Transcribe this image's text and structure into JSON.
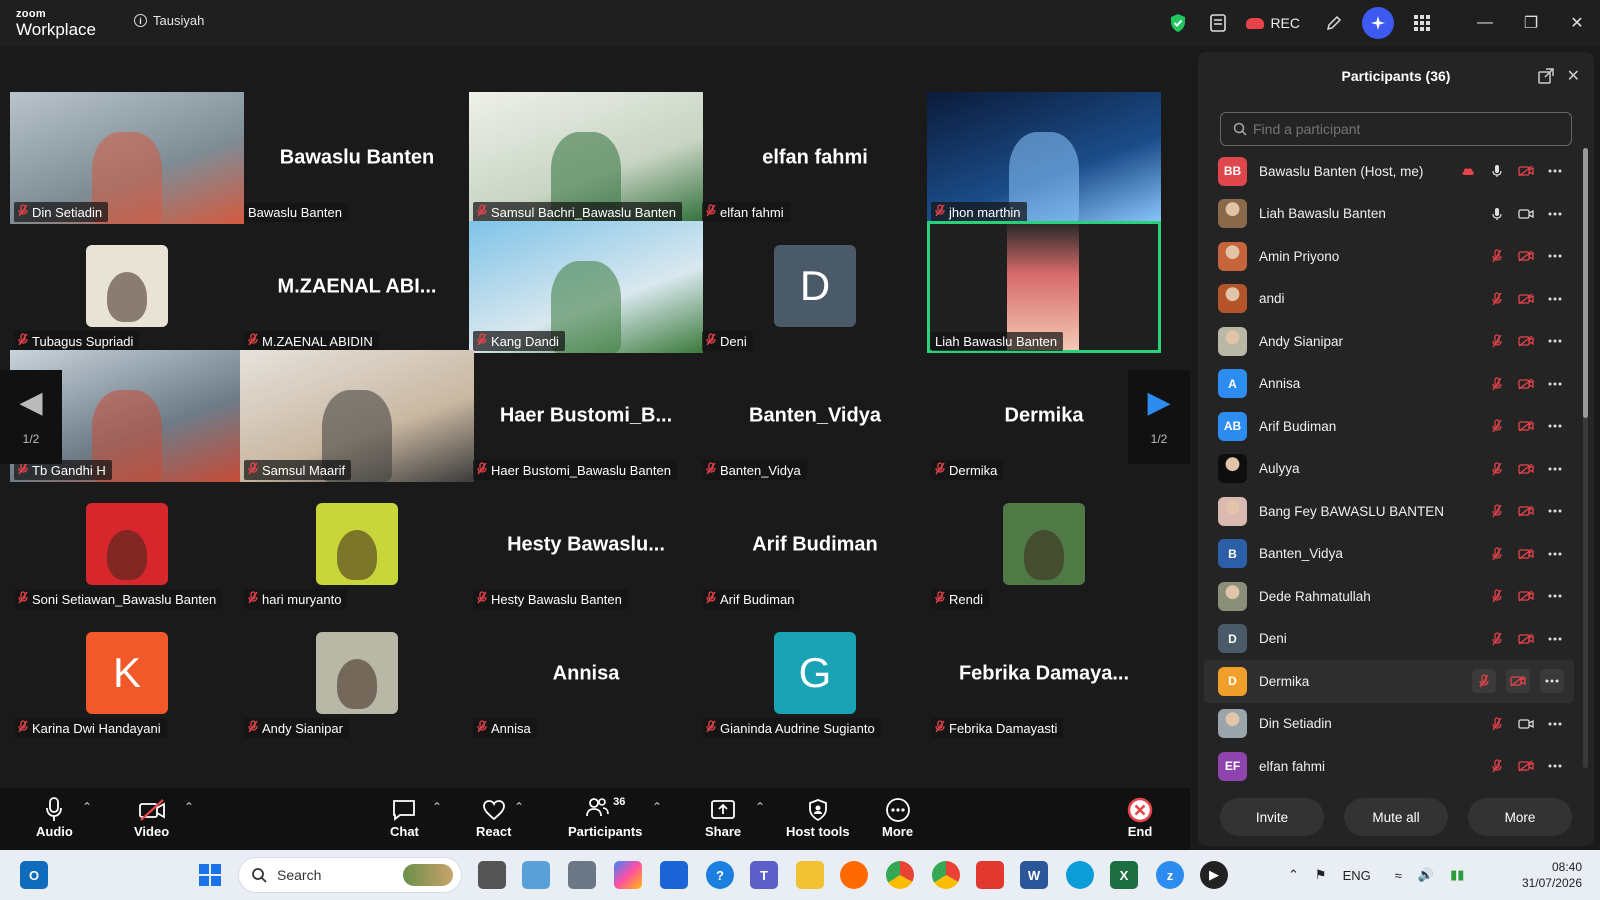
{
  "window": {
    "brand_top": "zoom",
    "brand_bottom": "Workplace",
    "meeting_title": "Tausiyah",
    "rec_label": "REC"
  },
  "grid": {
    "page_indicator": "1/2",
    "tiles": [
      {
        "name": "Din Setiadin",
        "center_label": "",
        "kind": "image",
        "palette": [
          "#b9c4cc",
          "#7e8c95",
          "#d45a3f"
        ],
        "muted": true
      },
      {
        "name": "Bawaslu Banten",
        "center_label": "Bawaslu Banten",
        "kind": "name",
        "muted": false
      },
      {
        "name": "Samsul Bachri_Bawaslu Banten",
        "center_label": "",
        "kind": "image",
        "palette": [
          "#eef0ea",
          "#c8d4c3",
          "#2f6f3a"
        ],
        "muted": true
      },
      {
        "name": "elfan fahmi",
        "center_label": "elfan fahmi",
        "kind": "name",
        "muted": true
      },
      {
        "name": "jhon marthin",
        "center_label": "",
        "kind": "image",
        "palette": [
          "#0b1b3a",
          "#1b4d8a",
          "#8ec8ff"
        ],
        "muted": true
      },
      {
        "name": "Tubagus Supriadi",
        "center_label": "",
        "kind": "avatar",
        "palette": [
          "#e9e3d6"
        ],
        "muted": true
      },
      {
        "name": "M.ZAENAL ABIDIN",
        "center_label": "M.ZAENAL  ABI...",
        "kind": "name",
        "muted": true
      },
      {
        "name": "Kang Dandi",
        "center_label": "",
        "kind": "image",
        "palette": [
          "#7fc3e8",
          "#d9e8ef",
          "#3b7a3a"
        ],
        "muted": true
      },
      {
        "name": "Deni",
        "center_label": "",
        "kind": "letter",
        "letter": "D",
        "palette": [
          "#4a5a68"
        ],
        "muted": true
      },
      {
        "name": "Liah Bawaslu Banten",
        "center_label": "",
        "kind": "speaker",
        "palette": [
          "#2a2a2a",
          "#d86b6b",
          "#f3c9b5"
        ],
        "muted": false
      },
      {
        "name": "Tb Gandhi H",
        "center_label": "",
        "kind": "image",
        "palette": [
          "#c9d3db",
          "#6d7c88",
          "#c84a35"
        ],
        "muted": true
      },
      {
        "name": "Samsul Maarif",
        "center_label": "",
        "kind": "image",
        "palette": [
          "#e6e2dc",
          "#c9b7a1",
          "#3b3b3b"
        ],
        "muted": true
      },
      {
        "name": "Haer Bustomi_Bawaslu Banten",
        "center_label": "Haer  Bustomi_B...",
        "kind": "name",
        "muted": true
      },
      {
        "name": "Banten_Vidya",
        "center_label": "Banten_Vidya",
        "kind": "name",
        "muted": true
      },
      {
        "name": "Dermika",
        "center_label": "Dermika",
        "kind": "name",
        "muted": true
      },
      {
        "name": "Soni Setiawan_Bawaslu Banten",
        "center_label": "",
        "kind": "avatar",
        "palette": [
          "#d8272c"
        ],
        "muted": true
      },
      {
        "name": "hari muryanto",
        "center_label": "",
        "kind": "avatar",
        "palette": [
          "#c9d63a"
        ],
        "muted": true
      },
      {
        "name": "Hesty Bawaslu Banten",
        "center_label": "Hesty  Bawaslu...",
        "kind": "name",
        "muted": true
      },
      {
        "name": "Arif Budiman",
        "center_label": "Arif Budiman",
        "kind": "name",
        "muted": true
      },
      {
        "name": "Rendi",
        "center_label": "",
        "kind": "avatar",
        "palette": [
          "#4f7a45"
        ],
        "muted": true
      },
      {
        "name": "Karina Dwi Handayani",
        "center_label": "",
        "kind": "letter",
        "letter": "K",
        "palette": [
          "#f2592a"
        ],
        "muted": true
      },
      {
        "name": "Andy Sianipar",
        "center_label": "",
        "kind": "avatar",
        "palette": [
          "#b9b7a6"
        ],
        "muted": true
      },
      {
        "name": "Annisa",
        "center_label": "Annisa",
        "kind": "name",
        "muted": true
      },
      {
        "name": "Gianinda Audrine Sugianto",
        "center_label": "",
        "kind": "letter",
        "letter": "G",
        "palette": [
          "#1aa3b5"
        ],
        "muted": true
      },
      {
        "name": "Febrika Damayasti",
        "center_label": "Febrika  Damaya...",
        "kind": "name",
        "muted": true
      }
    ]
  },
  "toolbar": {
    "audio": "Audio",
    "video": "Video",
    "chat": "Chat",
    "react": "React",
    "participants": "Participants",
    "participants_count": "36",
    "share": "Share",
    "host_tools": "Host tools",
    "more": "More",
    "end": "End"
  },
  "panel": {
    "title": "Participants (36)",
    "search_placeholder": "Find a participant",
    "invite": "Invite",
    "mute_all": "Mute all",
    "more": "More",
    "participants": [
      {
        "initials": "BB",
        "name": "Bawaslu Banten (Host, me)",
        "color": "#e0474c",
        "icons": [
          "cloud",
          "mic-on",
          "video-off",
          "more"
        ]
      },
      {
        "initials": "",
        "name": "Liah Bawaslu Banten",
        "color": "#8a6a4a",
        "icons": [
          "mic-on",
          "video-on",
          "more"
        ]
      },
      {
        "initials": "",
        "name": "Amin Priyono",
        "color": "#c8643c",
        "icons": [
          "mic-off",
          "video-off",
          "more"
        ]
      },
      {
        "initials": "",
        "name": "andi",
        "color": "#b4542a",
        "icons": [
          "mic-off",
          "video-off",
          "more"
        ]
      },
      {
        "initials": "",
        "name": "Andy Sianipar",
        "color": "#b9b7a6",
        "icons": [
          "mic-off",
          "video-off",
          "more"
        ]
      },
      {
        "initials": "A",
        "name": "Annisa",
        "color": "#2d8cf0",
        "icons": [
          "mic-off",
          "video-off",
          "more"
        ]
      },
      {
        "initials": "AB",
        "name": "Arif Budiman",
        "color": "#2d8cf0",
        "icons": [
          "mic-off",
          "video-off",
          "more"
        ]
      },
      {
        "initials": "",
        "name": "Aulyya",
        "color": "#0e0e0e",
        "icons": [
          "mic-off",
          "video-off",
          "more"
        ]
      },
      {
        "initials": "",
        "name": "Bang Fey BAWASLU BANTEN",
        "color": "#d9b9b0",
        "icons": [
          "mic-off",
          "video-off",
          "more"
        ]
      },
      {
        "initials": "B",
        "name": "Banten_Vidya",
        "color": "#2d5fa8",
        "icons": [
          "mic-off",
          "video-off",
          "more"
        ]
      },
      {
        "initials": "",
        "name": "Dede Rahmatullah",
        "color": "#8a8f7a",
        "icons": [
          "mic-off",
          "video-off",
          "more"
        ]
      },
      {
        "initials": "D",
        "name": "Deni",
        "color": "#4a5a68",
        "icons": [
          "mic-off",
          "video-off",
          "more"
        ]
      },
      {
        "initials": "D",
        "name": "Dermika",
        "color": "#f0a02a",
        "icons": [
          "mic-off",
          "video-off",
          "more"
        ],
        "hover": true
      },
      {
        "initials": "",
        "name": "Din Setiadin",
        "color": "#9aa4ab",
        "icons": [
          "mic-off",
          "video-on",
          "more"
        ]
      },
      {
        "initials": "EF",
        "name": "elfan fahmi",
        "color": "#8e44ad",
        "icons": [
          "mic-off",
          "video-off",
          "more"
        ]
      }
    ]
  },
  "taskbar": {
    "search_label": "Search",
    "lang": "ENG",
    "time": "08:40",
    "date": "31/07/2026"
  }
}
